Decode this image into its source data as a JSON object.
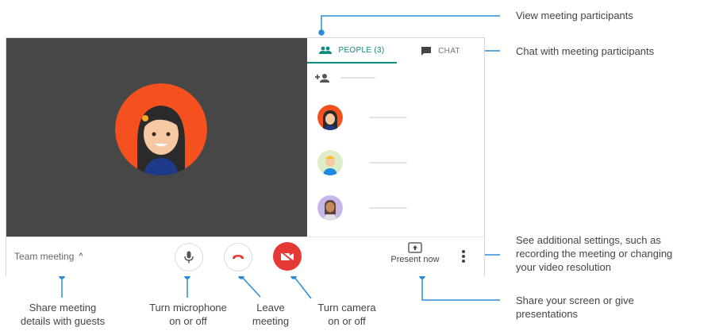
{
  "tabs": {
    "people": "PEOPLE (3)",
    "chat": "CHAT"
  },
  "bar": {
    "meeting_title": "Team meeting",
    "chevron": "^",
    "present_label": "Present now"
  },
  "icons": [
    "people-icon",
    "chat-icon",
    "add-person-icon",
    "microphone-icon",
    "phone-hangup-icon",
    "camera-off-icon",
    "present-screen-icon",
    "more-vert-icon"
  ],
  "colors": {
    "accent": "#0f8a7e",
    "connector": "#2a8bd6",
    "video_bg": "#474747",
    "leave_red": "#e53935",
    "avatar_orange": "#f4511e"
  },
  "annotations": {
    "view_participants": "View meeting participants",
    "chat_participants": "Chat with meeting participants",
    "settings_line1": "See additional settings, such as",
    "settings_line2": "recording the meeting or changing",
    "settings_line3": "your video resolution",
    "share_line1": "Share your screen or give",
    "share_line2": "presentations",
    "details_line1": "Share meeting",
    "details_line2": "details with guests",
    "mic_line1": "Turn microphone",
    "mic_line2": "on or off",
    "leave_line1": "Leave",
    "leave_line2": "meeting",
    "camera_line1": "Turn camera",
    "camera_line2": "on or off"
  }
}
